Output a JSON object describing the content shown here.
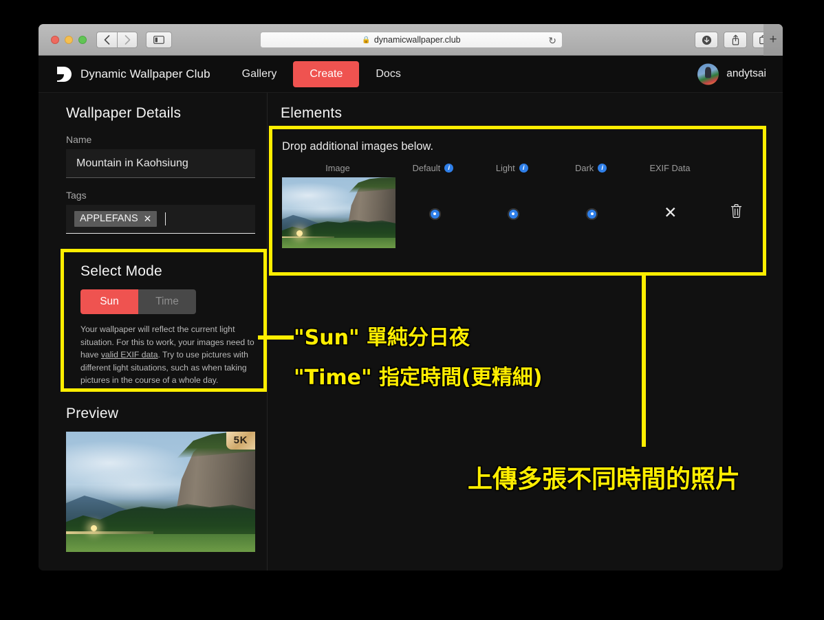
{
  "browser": {
    "url": "dynamicwallpaper.club",
    "lock_icon": "lock-icon",
    "back_icon": "chevron-left-icon",
    "forward_icon": "chevron-right-icon",
    "sidebar_icon": "sidebar-toggle-icon",
    "reload_icon": "reload-icon",
    "download_icon": "download-icon",
    "share_icon": "share-icon",
    "tabs_icon": "tab-overview-icon",
    "new_tab_label": "+"
  },
  "header": {
    "brand_name": "Dynamic Wallpaper Club",
    "nav": [
      {
        "label": "Gallery",
        "active": false
      },
      {
        "label": "Create",
        "active": true
      },
      {
        "label": "Docs",
        "active": false
      }
    ],
    "username": "andytsai"
  },
  "sidebar": {
    "title": "Wallpaper Details",
    "name_label": "Name",
    "name_value": "Mountain in Kaohsiung",
    "name_placeholder": "Name",
    "tags_label": "Tags",
    "tags": [
      {
        "label": "APPLEFANS",
        "remove_icon": "close-icon"
      }
    ],
    "tags_placeholder": "",
    "select_mode": {
      "title": "Select Mode",
      "options": [
        {
          "label": "Sun",
          "selected": true
        },
        {
          "label": "Time",
          "selected": false
        }
      ],
      "description_a": "Your wallpaper will reflect the current light situation. For this to work, your images need to have ",
      "description_link": "valid EXIF data",
      "description_b": ". Try to use pictures with different light situations, such as when taking pictures in the course of a whole day."
    },
    "preview": {
      "title": "Preview",
      "resolution_badge": "5K"
    }
  },
  "main": {
    "title": "Elements",
    "drop_hint": "Drop additional images below.",
    "columns": [
      {
        "label": "Image",
        "has_info": false
      },
      {
        "label": "Default",
        "has_info": true
      },
      {
        "label": "Light",
        "has_info": true
      },
      {
        "label": "Dark",
        "has_info": true
      },
      {
        "label": "EXIF Data",
        "has_info": false
      }
    ],
    "info_glyph": "i",
    "rows": [
      {
        "image_alt": "mountain-thumbnail",
        "default_selected": true,
        "light_selected": true,
        "dark_selected": true,
        "exif_icon": "close-icon",
        "delete_icon": "trash-icon"
      }
    ]
  },
  "annotations": {
    "mode_line_1": "\"Sun\" 單純分日夜",
    "mode_line_2": "\"Time\" 指定時間(更精細)",
    "upload_note": "上傳多張不同時間的照片",
    "highlight_color": "#ffee00"
  }
}
